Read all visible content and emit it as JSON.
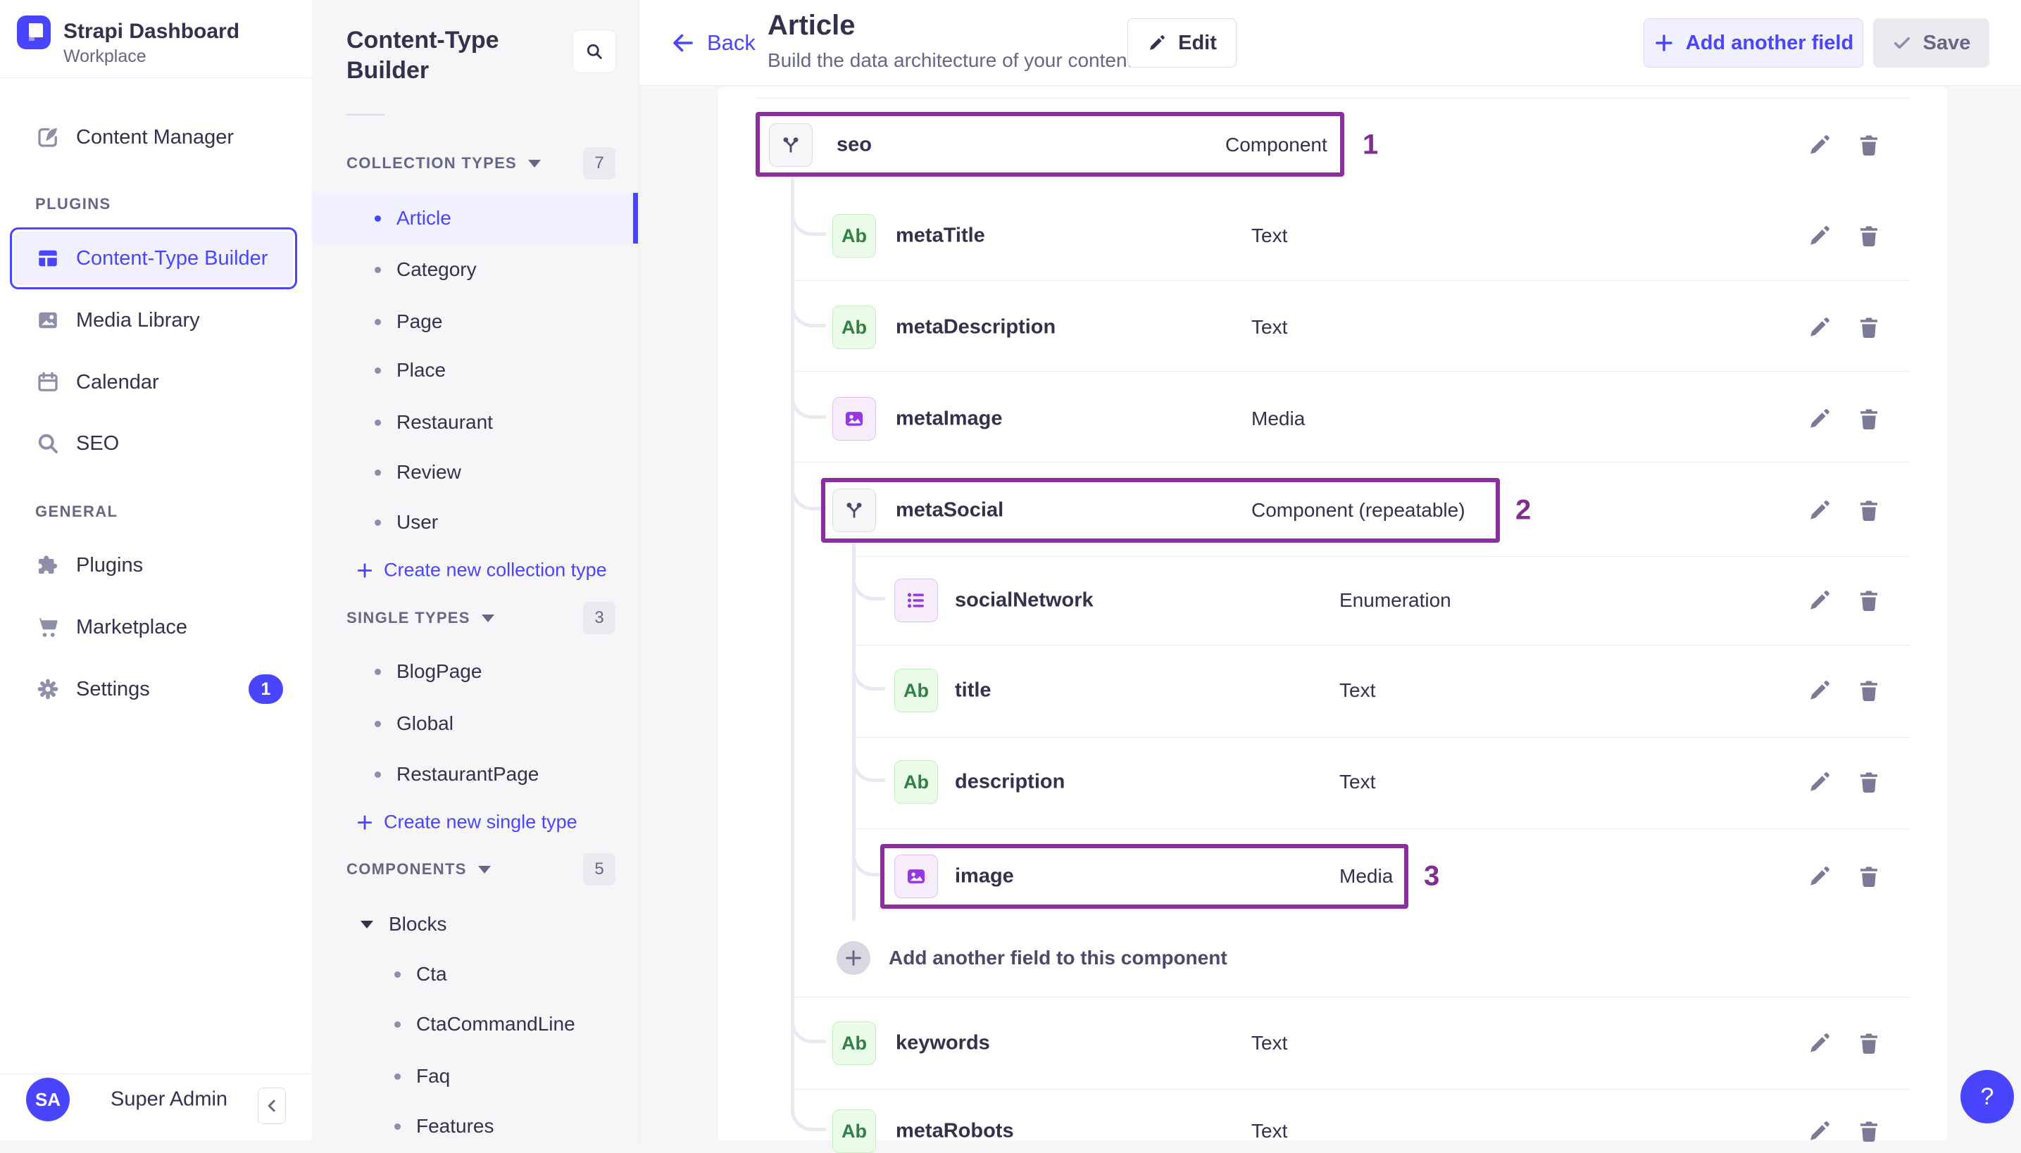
{
  "app": {
    "name": "Strapi Dashboard",
    "workspace": "Workplace",
    "user_initials": "SA",
    "user_name": "Super Admin",
    "help_label": "?"
  },
  "colors": {
    "primary": "#4945FF",
    "primary_bg": "#F0F0FF",
    "annotation_purple": "#8B2FA0",
    "text_dark": "#32324D",
    "text_gray": "#666687",
    "page_bg": "#F6F6F9",
    "text_field_green": "#328048",
    "purple_field_icon": "#9736E8"
  },
  "nav": {
    "content_manager": "Content Manager",
    "plugins_section": "PLUGINS",
    "plugins_items": [
      "Content-Type Builder",
      "Media Library",
      "Calendar",
      "SEO"
    ],
    "general_section": "GENERAL",
    "general_items": [
      "Plugins",
      "Marketplace",
      "Settings"
    ],
    "settings_badge": "1"
  },
  "subnav": {
    "title": "Content-Type Builder",
    "collection_types": {
      "label": "COLLECTION TYPES",
      "badge": "7",
      "items": [
        "Article",
        "Category",
        "Page",
        "Place",
        "Restaurant",
        "Review",
        "User"
      ],
      "active_item": "Article",
      "action": "Create new collection type"
    },
    "single_types": {
      "label": "SINGLE TYPES",
      "badge": "3",
      "items": [
        "BlogPage",
        "Global",
        "RestaurantPage"
      ],
      "action": "Create new single type"
    },
    "components": {
      "label": "COMPONENTS",
      "badge": "5",
      "group": "Blocks",
      "items": [
        "Cta",
        "CtaCommandLine",
        "Faq",
        "Features"
      ]
    }
  },
  "header": {
    "back_label": "Back",
    "title": "Article",
    "subtitle": "Build the data architecture of your content",
    "edit_label": "Edit",
    "add_field_label": "Add another field",
    "save_label": "Save"
  },
  "ab_label": "Ab",
  "fields": [
    {
      "name": "seo",
      "type": "Component",
      "icon": "component",
      "annotation": "1"
    },
    {
      "name": "metaTitle",
      "type": "Text",
      "icon": "text"
    },
    {
      "name": "metaDescription",
      "type": "Text",
      "icon": "text"
    },
    {
      "name": "metaImage",
      "type": "Media",
      "icon": "media"
    },
    {
      "name": "metaSocial",
      "type": "Component (repeatable)",
      "icon": "component",
      "annotation": "2"
    },
    {
      "name": "socialNetwork",
      "type": "Enumeration",
      "icon": "enumeration"
    },
    {
      "name": "title",
      "type": "Text",
      "icon": "text"
    },
    {
      "name": "description",
      "type": "Text",
      "icon": "text"
    },
    {
      "name": "image",
      "type": "Media",
      "icon": "media",
      "annotation": "3"
    },
    {
      "name": "keywords",
      "type": "Text",
      "icon": "text"
    },
    {
      "name": "metaRobots",
      "type": "Text",
      "icon": "text"
    }
  ],
  "add_component_field_label": "Add another field to this component"
}
